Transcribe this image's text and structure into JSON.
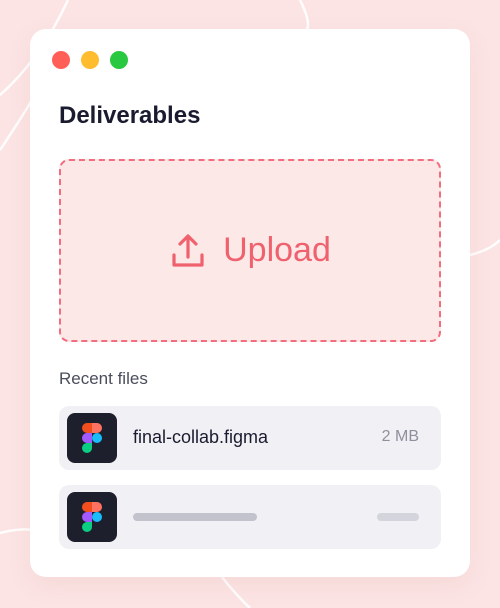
{
  "window": {
    "title": "Deliverables",
    "controls": [
      "close",
      "minimize",
      "maximize"
    ]
  },
  "upload": {
    "label": "Upload",
    "icon": "upload-icon",
    "accent_color": "#f0616e"
  },
  "recent": {
    "heading": "Recent files",
    "files": [
      {
        "name": "final-collab.figma",
        "size": "2 MB",
        "icon": "figma-icon"
      },
      {
        "name": "",
        "size": "",
        "icon": "figma-icon",
        "placeholder": true
      }
    ]
  },
  "colors": {
    "background": "#fce4e4",
    "upload_zone_bg": "#fde8e8",
    "upload_border": "#f26d7d",
    "file_row_bg": "#f1f1f5"
  }
}
